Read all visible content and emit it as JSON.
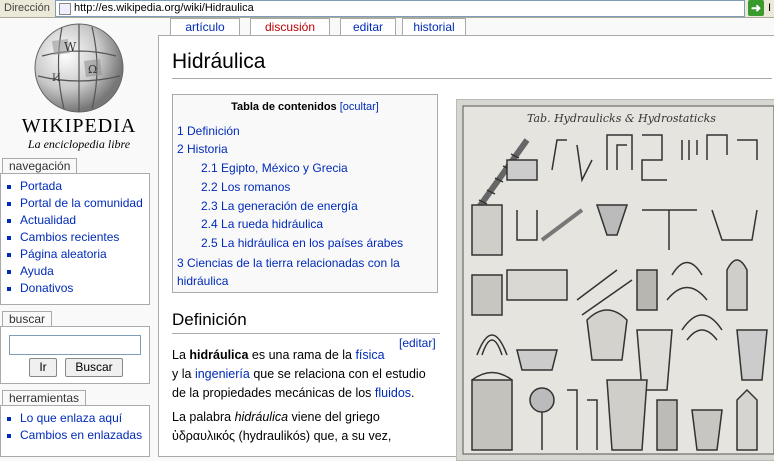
{
  "address_bar": {
    "label": "Dirección",
    "url": "http://es.wikipedia.org/wiki/Hidraulica",
    "go_partial": "I"
  },
  "logo": {
    "name": "WIKIPEDIA",
    "tagline": "La enciclopedia libre"
  },
  "sidebar": {
    "nav_title": "navegación",
    "nav_items": [
      "Portada",
      "Portal de la comunidad",
      "Actualidad",
      "Cambios recientes",
      "Página aleatoria",
      "Ayuda",
      "Donativos"
    ],
    "search_title": "buscar",
    "search_go": "Ir",
    "search_button": "Buscar",
    "tools_title": "herramientas",
    "tools_items": [
      "Lo que enlaza aquí",
      "Cambios en enlazadas"
    ]
  },
  "tabs": [
    "artículo",
    "discusión",
    "editar",
    "historial"
  ],
  "page": {
    "title": "Hidráulica",
    "toc_title": "Tabla de contenidos",
    "toc_toggle": "[ocultar]",
    "toc": [
      {
        "text": "1 Definición",
        "level": 1
      },
      {
        "text": "2 Historia",
        "level": 1
      },
      {
        "text": "2.1 Egipto, México y Grecia",
        "level": 2
      },
      {
        "text": "2.2 Los romanos",
        "level": 2
      },
      {
        "text": "2.3 La generación de energía",
        "level": 2
      },
      {
        "text": "2.4 La rueda hidráulica",
        "level": 2
      },
      {
        "text": "2.5 La hidráulica en los países árabes",
        "level": 2
      },
      {
        "text": "3 Ciencias de la tierra relacionadas con la",
        "level": 1
      },
      {
        "text": "hidráulica",
        "level": 1
      }
    ],
    "section_heading": "Definición",
    "edit_link": "[editar]",
    "para1_line1_a": "La ",
    "para1_line1_b": "hidráulica",
    "para1_line1_c": " es una rama de la ",
    "para1_line1_link": "física",
    "para1_line2_a": "y la ",
    "para1_line2_link": "ingeniería",
    "para1_line2_b": " que se relaciona con el estudio",
    "para1_line3_a": "de la propiedades mecánicas de los ",
    "para1_line3_link": "fluidos",
    "para1_line3_b": ".",
    "para2_line1_a": "La palabra ",
    "para2_line1_b": "hidráulica",
    "para2_line1_c": " viene del griego",
    "para2_line2": "ὑδραυλικός (hydraulikós) que, a su vez,",
    "illustration_caption": "Tab. Hydraulicks & Hydrostaticks"
  }
}
